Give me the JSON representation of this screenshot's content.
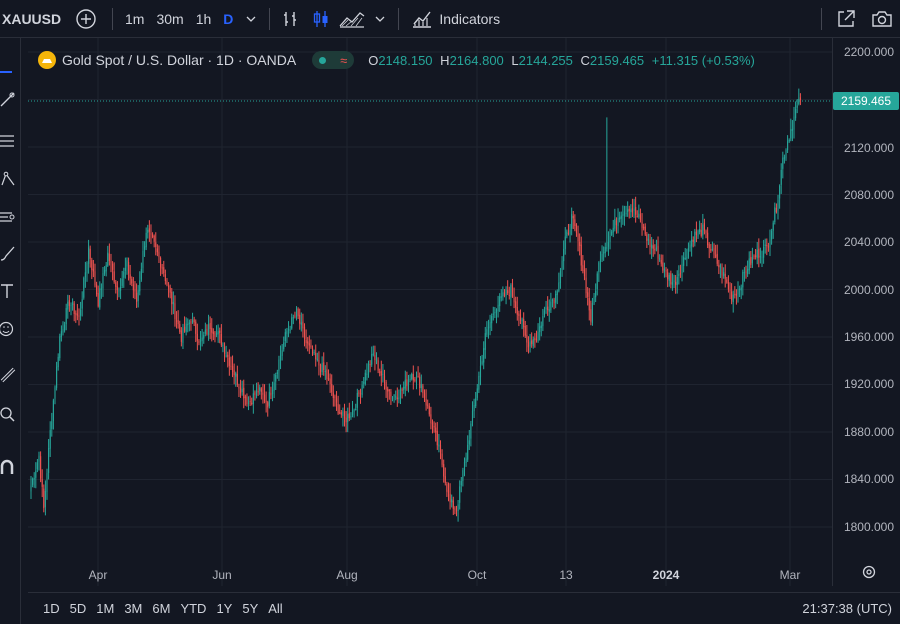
{
  "header": {
    "symbol": "XAUUSD",
    "intervals": [
      "1m",
      "30m",
      "1h",
      "D"
    ],
    "active_interval": "D",
    "indicators_label": "Indicators"
  },
  "legend": {
    "title": "Gold Spot / U.S. Dollar · 1D · OANDA",
    "o_label": "O",
    "o_value": "2148.150",
    "h_label": "H",
    "h_value": "2164.800",
    "l_label": "L",
    "l_value": "2144.255",
    "c_label": "C",
    "c_value": "2159.465",
    "change": "+11.315 (+0.53%)",
    "up_color": "#26a69a",
    "down_color": "#ef5350"
  },
  "price_axis": {
    "ticks": [
      "2200.000",
      "2120.000",
      "2080.000",
      "2040.000",
      "2000.000",
      "1960.000",
      "1920.000",
      "1880.000",
      "1840.000",
      "1800.000"
    ],
    "last_price": "2159.465"
  },
  "time_axis": {
    "labels": [
      "Apr",
      "Jun",
      "Aug",
      "Oct",
      "13",
      "2024",
      "Mar"
    ]
  },
  "ranges": [
    "1D",
    "5D",
    "1M",
    "3M",
    "6M",
    "YTD",
    "1Y",
    "5Y",
    "All"
  ],
  "clock": "21:37:38 (UTC)",
  "chart_data": {
    "type": "candlestick",
    "ylim": [
      1790,
      2205
    ],
    "anchors": [
      [
        0,
        1835
      ],
      [
        5,
        1860
      ],
      [
        8,
        1815
      ],
      [
        12,
        1880
      ],
      [
        18,
        1960
      ],
      [
        24,
        1990
      ],
      [
        30,
        1975
      ],
      [
        36,
        2035
      ],
      [
        42,
        1990
      ],
      [
        48,
        2030
      ],
      [
        54,
        2000
      ],
      [
        60,
        2020
      ],
      [
        66,
        1990
      ],
      [
        72,
        2050
      ],
      [
        76,
        2040
      ],
      [
        82,
        2020
      ],
      [
        88,
        1990
      ],
      [
        94,
        1960
      ],
      [
        100,
        1975
      ],
      [
        106,
        1955
      ],
      [
        112,
        1970
      ],
      [
        118,
        1960
      ],
      [
        124,
        1940
      ],
      [
        130,
        1920
      ],
      [
        136,
        1905
      ],
      [
        142,
        1915
      ],
      [
        148,
        1905
      ],
      [
        154,
        1935
      ],
      [
        160,
        1965
      ],
      [
        166,
        1980
      ],
      [
        172,
        1955
      ],
      [
        178,
        1940
      ],
      [
        184,
        1930
      ],
      [
        190,
        1905
      ],
      [
        196,
        1890
      ],
      [
        202,
        1900
      ],
      [
        208,
        1925
      ],
      [
        214,
        1945
      ],
      [
        220,
        1925
      ],
      [
        226,
        1910
      ],
      [
        232,
        1915
      ],
      [
        238,
        1930
      ],
      [
        244,
        1920
      ],
      [
        250,
        1890
      ],
      [
        256,
        1860
      ],
      [
        262,
        1820
      ],
      [
        266,
        1815
      ],
      [
        272,
        1860
      ],
      [
        278,
        1910
      ],
      [
        284,
        1960
      ],
      [
        290,
        1985
      ],
      [
        296,
        1995
      ],
      [
        300,
        2000
      ],
      [
        306,
        1975
      ],
      [
        310,
        1955
      ],
      [
        316,
        1960
      ],
      [
        322,
        1985
      ],
      [
        328,
        1995
      ],
      [
        334,
        2040
      ],
      [
        338,
        2060
      ],
      [
        342,
        2040
      ],
      [
        346,
        2010
      ],
      [
        350,
        1975
      ],
      [
        356,
        2030
      ],
      [
        362,
        2045
      ],
      [
        368,
        2065
      ],
      [
        374,
        2070
      ],
      [
        380,
        2060
      ],
      [
        386,
        2040
      ],
      [
        392,
        2030
      ],
      [
        396,
        2015
      ],
      [
        402,
        2005
      ],
      [
        408,
        2025
      ],
      [
        414,
        2045
      ],
      [
        420,
        2050
      ],
      [
        426,
        2030
      ],
      [
        432,
        2015
      ],
      [
        438,
        1995
      ],
      [
        442,
        2000
      ],
      [
        448,
        2020
      ],
      [
        454,
        2030
      ],
      [
        460,
        2035
      ],
      [
        466,
        2070
      ],
      [
        470,
        2110
      ],
      [
        474,
        2130
      ],
      [
        478,
        2150
      ],
      [
        481,
        2159
      ]
    ]
  }
}
